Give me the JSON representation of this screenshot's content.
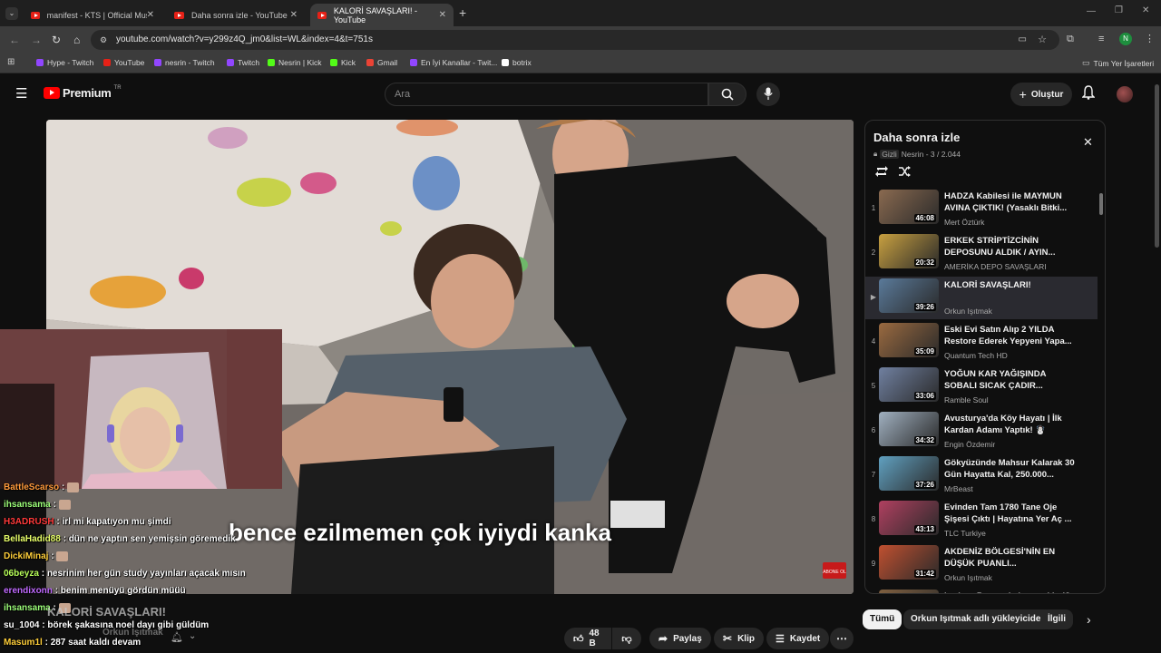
{
  "browser": {
    "tabs": [
      {
        "label": "manifest - KTS | Official Music V",
        "active": false
      },
      {
        "label": "Daha sonra izle - YouTube",
        "active": false
      },
      {
        "label": "KALORİ SAVAŞLARI! - YouTube",
        "active": true
      }
    ],
    "url": "youtube.com/watch?v=y299z4Q_jm0&list=WL&index=4&t=751s",
    "profile_initial": "N",
    "bookmarks": [
      {
        "label": "Hype - Twitch",
        "color": "#9146ff"
      },
      {
        "label": "YouTube",
        "color": "#e62117"
      },
      {
        "label": "nesrin - Twitch",
        "color": "#9146ff"
      },
      {
        "label": "Twitch",
        "color": "#9146ff"
      },
      {
        "label": "Nesrin | Kick",
        "color": "#53fc18"
      },
      {
        "label": "Kick",
        "color": "#53fc18"
      },
      {
        "label": "Gmail",
        "color": "#ea4335"
      },
      {
        "label": "En İyi Kanallar - Twit...",
        "color": "#9146ff"
      },
      {
        "label": "botrix",
        "color": "#ffffff"
      }
    ],
    "all_bookmarks": "Tüm Yer İşaretleri"
  },
  "youtube": {
    "logo_text": "Premium",
    "region": "TR",
    "search_placeholder": "Ara",
    "create_label": "Oluştur"
  },
  "video": {
    "subtitle": "bence ezilmemen çok iyiydi kanka",
    "subscribe_badge": "ABONE OL"
  },
  "playlist": {
    "title": "Daha sonra izle",
    "privacy": "Gizli",
    "meta": "Nesrin - 3 / 2.044",
    "items": [
      {
        "num": "1",
        "title": "HADZA Kabilesi ile MAYMUN AVINA ÇIKTIK! (Yasaklı Bitki...",
        "channel": "Mert Öztürk",
        "duration": "46:08",
        "color": "#8a6a50"
      },
      {
        "num": "2",
        "title": "ERKEK STRİPTİZCİNİN DEPOSUNU ALDIK / AYIN...",
        "channel": "AMERİKA DEPO SAVAŞLARI",
        "duration": "20:32",
        "color": "#c8a040"
      },
      {
        "num": "▶",
        "title": "KALORİ SAVAŞLARI!",
        "channel": "Orkun Işıtmak",
        "duration": "39:26",
        "color": "#5a7a9a",
        "active": true
      },
      {
        "num": "4",
        "title": "Eski Evi Satın Alıp 2 YILDA Restore Ederek Yepyeni Yapa...",
        "channel": "Quantum Tech HD",
        "duration": "35:09",
        "color": "#9a6a40"
      },
      {
        "num": "5",
        "title": "YOĞUN KAR YAĞIŞINDA SOBALI SICAK ÇADIR...",
        "channel": "Ramble Soul",
        "duration": "33:06",
        "color": "#7080a0"
      },
      {
        "num": "6",
        "title": "Avusturya'da Köy Hayatı | İlk Kardan Adamı Yaptık! ☃️",
        "channel": "Engin Özdemir",
        "duration": "34:32",
        "color": "#a0b0c0"
      },
      {
        "num": "7",
        "title": "Gökyüzünde Mahsur Kalarak 30 Gün Hayatta Kal, 250.000...",
        "channel": "MrBeast",
        "duration": "37:26",
        "color": "#60a0c0"
      },
      {
        "num": "8",
        "title": "Evinden Tam 1780 Tane Oje Şişesi Çıktı | Hayatına Yer Aç ...",
        "channel": "TLC Turkiye",
        "duration": "43:13",
        "color": "#b04060"
      },
      {
        "num": "9",
        "title": "AKDENİZ BÖLGESİ'NİN EN DÜŞÜK PUANLI...",
        "channel": "Orkun Işıtmak",
        "duration": "31:42",
        "color": "#c05030"
      },
      {
        "num": "10",
        "title": "kız kıza Peru sokak yemekleri?",
        "channel": "",
        "duration": "10:10",
        "color": "#806040"
      }
    ]
  },
  "chips": [
    {
      "label": "Tümü",
      "selected": true
    },
    {
      "label": "Orkun Işıtmak adlı yükleyiciden",
      "selected": false
    },
    {
      "label": "İlgili",
      "selected": false
    }
  ],
  "actions": {
    "likes": "48 B",
    "share": "Paylaş",
    "clip": "Klip",
    "save": "Kaydet"
  },
  "title_overlay": "KALORİ SAVAŞLARI!",
  "channel_overlay": "Orkun Işıtmak",
  "chat": [
    {
      "user": "BattleScarso",
      "color": "#ff9a3c",
      "text": "",
      "emote": true
    },
    {
      "user": "ihsansama",
      "color": "#9dff7a",
      "text": "",
      "emote": true
    },
    {
      "user": "H3ADRUSH",
      "color": "#ff3a3a",
      "text": "irl mi kapatıyon mu şimdi",
      "emote": false
    },
    {
      "user": "BellaHadid88",
      "color": "#e8ff6a",
      "text": "dün ne yaptın sen yemişsin göremedik",
      "emote": false
    },
    {
      "user": "DickiMinaj",
      "color": "#ffcf3a",
      "text": "",
      "emote": true
    },
    {
      "user": "06beyza",
      "color": "#b8ff5a",
      "text": "nesrinim her gün study yayınları açacak mısın",
      "emote": false
    },
    {
      "user": "erendixonn",
      "color": "#c06aff",
      "text": "benim menüyü gördün müüü",
      "emote": false
    },
    {
      "user": "ihsansama",
      "color": "#9dff7a",
      "text": "",
      "emote": true
    },
    {
      "user": "su_1004",
      "color": "#ffffff",
      "text": "börek şakasına noel dayı gibi güldüm",
      "emote": false
    },
    {
      "user": "Masum1l",
      "color": "#ffcf3a",
      "text": "287 saat kaldı devam",
      "emote": false
    }
  ]
}
